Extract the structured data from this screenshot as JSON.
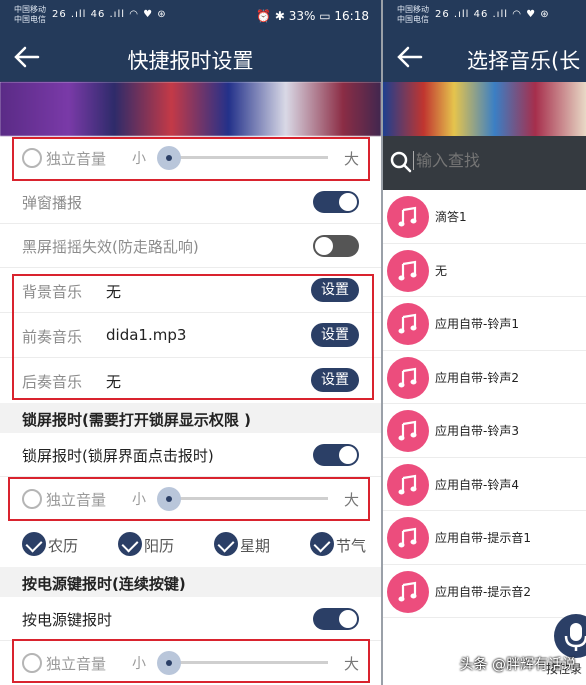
{
  "status_left": {
    "carrier1": "中国移动",
    "carrier2": "中国电信",
    "signal": "26 .ıll 46 .ıll ◠ ♥ ⊛",
    "right": "⏰ ✱ 33% ▭ 16:18"
  },
  "status_right": {
    "carrier1": "中国移动",
    "carrier2": "中国电信",
    "signal": "26 .ıll 46 .ıll ◠ ♥ ⊛"
  },
  "left_panel": {
    "title": "快捷报时设置",
    "volume_label": "独立音量",
    "volume_small": "小",
    "volume_big": "大",
    "popup_broadcast": "弹窗播报",
    "blackscreen_shake": "黑屏摇摇失效(防走路乱响)",
    "music_rows": [
      {
        "label": "背景音乐",
        "value": "无",
        "button": "设置"
      },
      {
        "label": "前奏音乐",
        "value": "dida1.mp3",
        "button": "设置"
      },
      {
        "label": "后奏音乐",
        "value": "无",
        "button": "设置"
      }
    ],
    "lock_section": "锁屏报时(需要打开锁屏显示权限 )",
    "lock_toggle_label": "锁屏报时(锁屏界面点击报时)",
    "checks": [
      "农历",
      "阳历",
      "星期",
      "节气"
    ],
    "power_section": "按电源键报时(连续按键)",
    "power_toggle_label": "按电源键报时"
  },
  "right_panel": {
    "title": "选择音乐(长",
    "search_placeholder": "输入查找",
    "items": [
      "滴答1",
      "无",
      "应用自带-铃声1",
      "应用自带-铃声2",
      "应用自带-铃声3",
      "应用自带-铃声4",
      "应用自带-提示音1",
      "应用自带-提示音2"
    ],
    "mic_label": "按住录",
    "watermark": "头条 @胖辉有话说"
  },
  "colors": {
    "header": "#243a5a",
    "accent": "#2b3f66",
    "highlight_box": "#d9232e",
    "music_disc": "#ec4d7d"
  },
  "states": {
    "popup_broadcast": true,
    "blackscreen_shake": false,
    "lock_toggle": true,
    "power_toggle": true,
    "volume_level": 0.02
  }
}
